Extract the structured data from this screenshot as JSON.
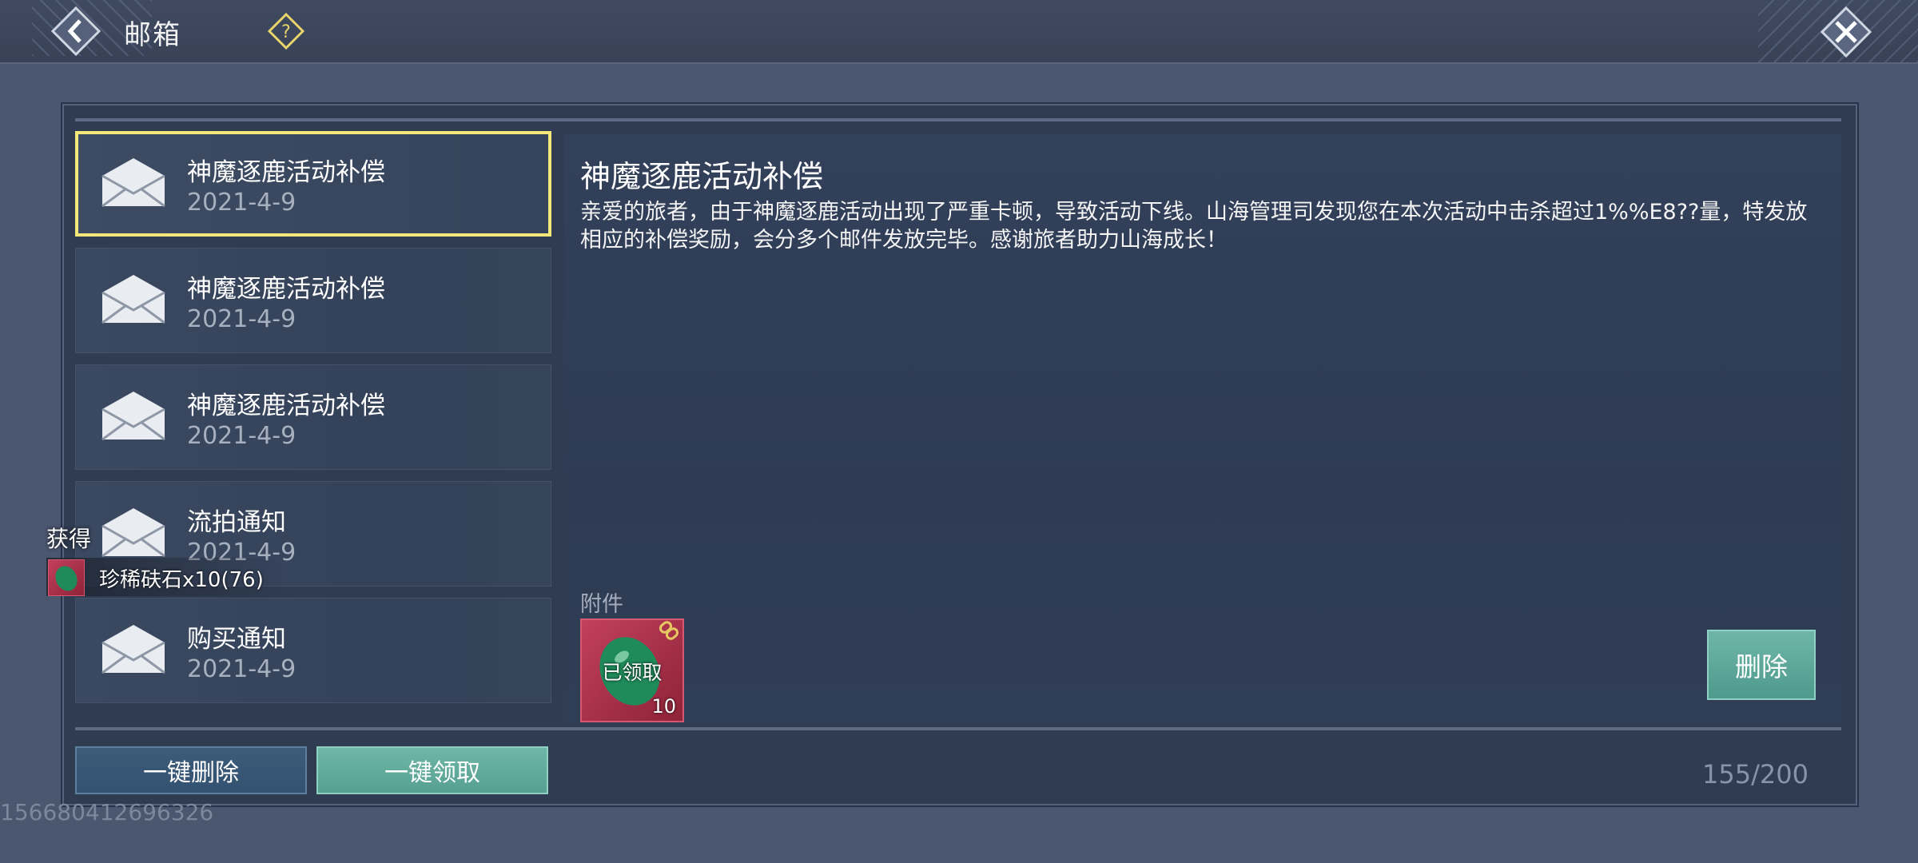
{
  "header": {
    "title": "邮箱",
    "back_icon": "back-arrow-icon",
    "help_icon": "question-mark-icon",
    "close_icon": "close-x-icon"
  },
  "mail_list": [
    {
      "title": "神魔逐鹿活动补偿",
      "date": "2021-4-9",
      "selected": true
    },
    {
      "title": "神魔逐鹿活动补偿",
      "date": "2021-4-9",
      "selected": false
    },
    {
      "title": "神魔逐鹿活动补偿",
      "date": "2021-4-9",
      "selected": false
    },
    {
      "title": "流拍通知",
      "date": "2021-4-9",
      "selected": false
    },
    {
      "title": "购买通知",
      "date": "2021-4-9",
      "selected": false
    }
  ],
  "detail": {
    "title": "神魔逐鹿活动补偿",
    "body": "亲爱的旅者，由于神魔逐鹿活动出现了严重卡顿，导致活动下线。山海管理司发现您在本次活动中击杀超过1%%E8??量，特发放相应的补偿奖励，会分多个邮件发放完毕。感谢旅者助力山海成长！",
    "attachment_label": "附件",
    "attachment": {
      "status": "已领取",
      "count": "10"
    },
    "delete_label": "删除"
  },
  "footer": {
    "delete_all_label": "一键删除",
    "claim_all_label": "一键领取",
    "counter": "155/200"
  },
  "toast": {
    "label": "获得",
    "item_text": "珍稀砆石x10(76)"
  },
  "uid": "156680412696326",
  "colors": {
    "accent_teal": "#5aa89a",
    "selected_border": "#f5e87a",
    "help_yellow": "#e8d46a"
  }
}
